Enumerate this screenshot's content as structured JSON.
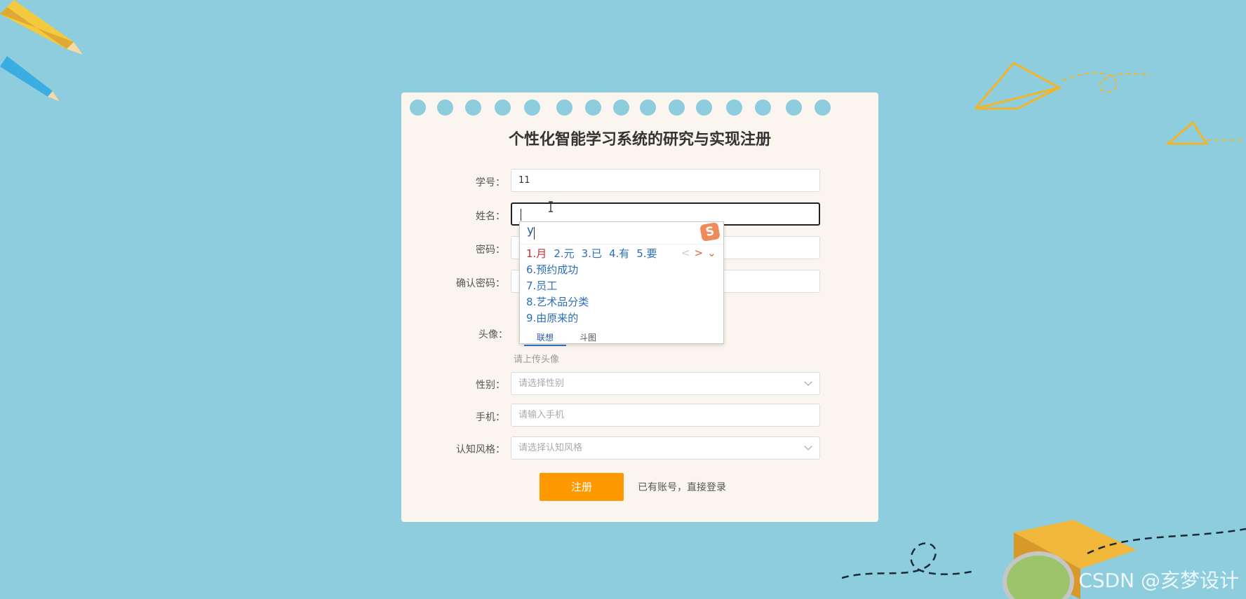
{
  "form": {
    "title": "个性化智能学习系统的研究与实现注册",
    "fields": {
      "student_id": {
        "label": "学号：",
        "value": "11"
      },
      "name": {
        "label": "姓名：",
        "value": ""
      },
      "password": {
        "label": "密码：",
        "value": ""
      },
      "confirm_password": {
        "label": "确认密码：",
        "value": ""
      },
      "avatar": {
        "label": "头像：",
        "hint": "请上传头像"
      },
      "gender": {
        "label": "性别：",
        "placeholder": "请选择性别"
      },
      "phone": {
        "label": "手机：",
        "placeholder": "请输入手机"
      },
      "cognitive_style": {
        "label": "认知风格：",
        "placeholder": "请选择认知风格"
      }
    },
    "register_button": "注册",
    "login_link": "已有账号，直接登录"
  },
  "ime": {
    "input": "y",
    "candidates_row": [
      "1.月",
      "2.元",
      "3.已",
      "4.有",
      "5.要"
    ],
    "candidates_list": [
      "6.预约成功",
      "7.员工",
      "8.艺术品分类",
      "9.由原来的"
    ],
    "nav": {
      "prev": "<",
      "next": ">",
      "more": "⌄"
    },
    "tabs": [
      "联想",
      "斗图"
    ],
    "logo": "S"
  },
  "watermark": "CSDN @亥梦设计",
  "colors": {
    "background": "#8dcddd",
    "card": "#faf5ee",
    "button": "#ff9900",
    "ime_candidate": "#2b6fb8",
    "ime_first": "#c53030"
  }
}
